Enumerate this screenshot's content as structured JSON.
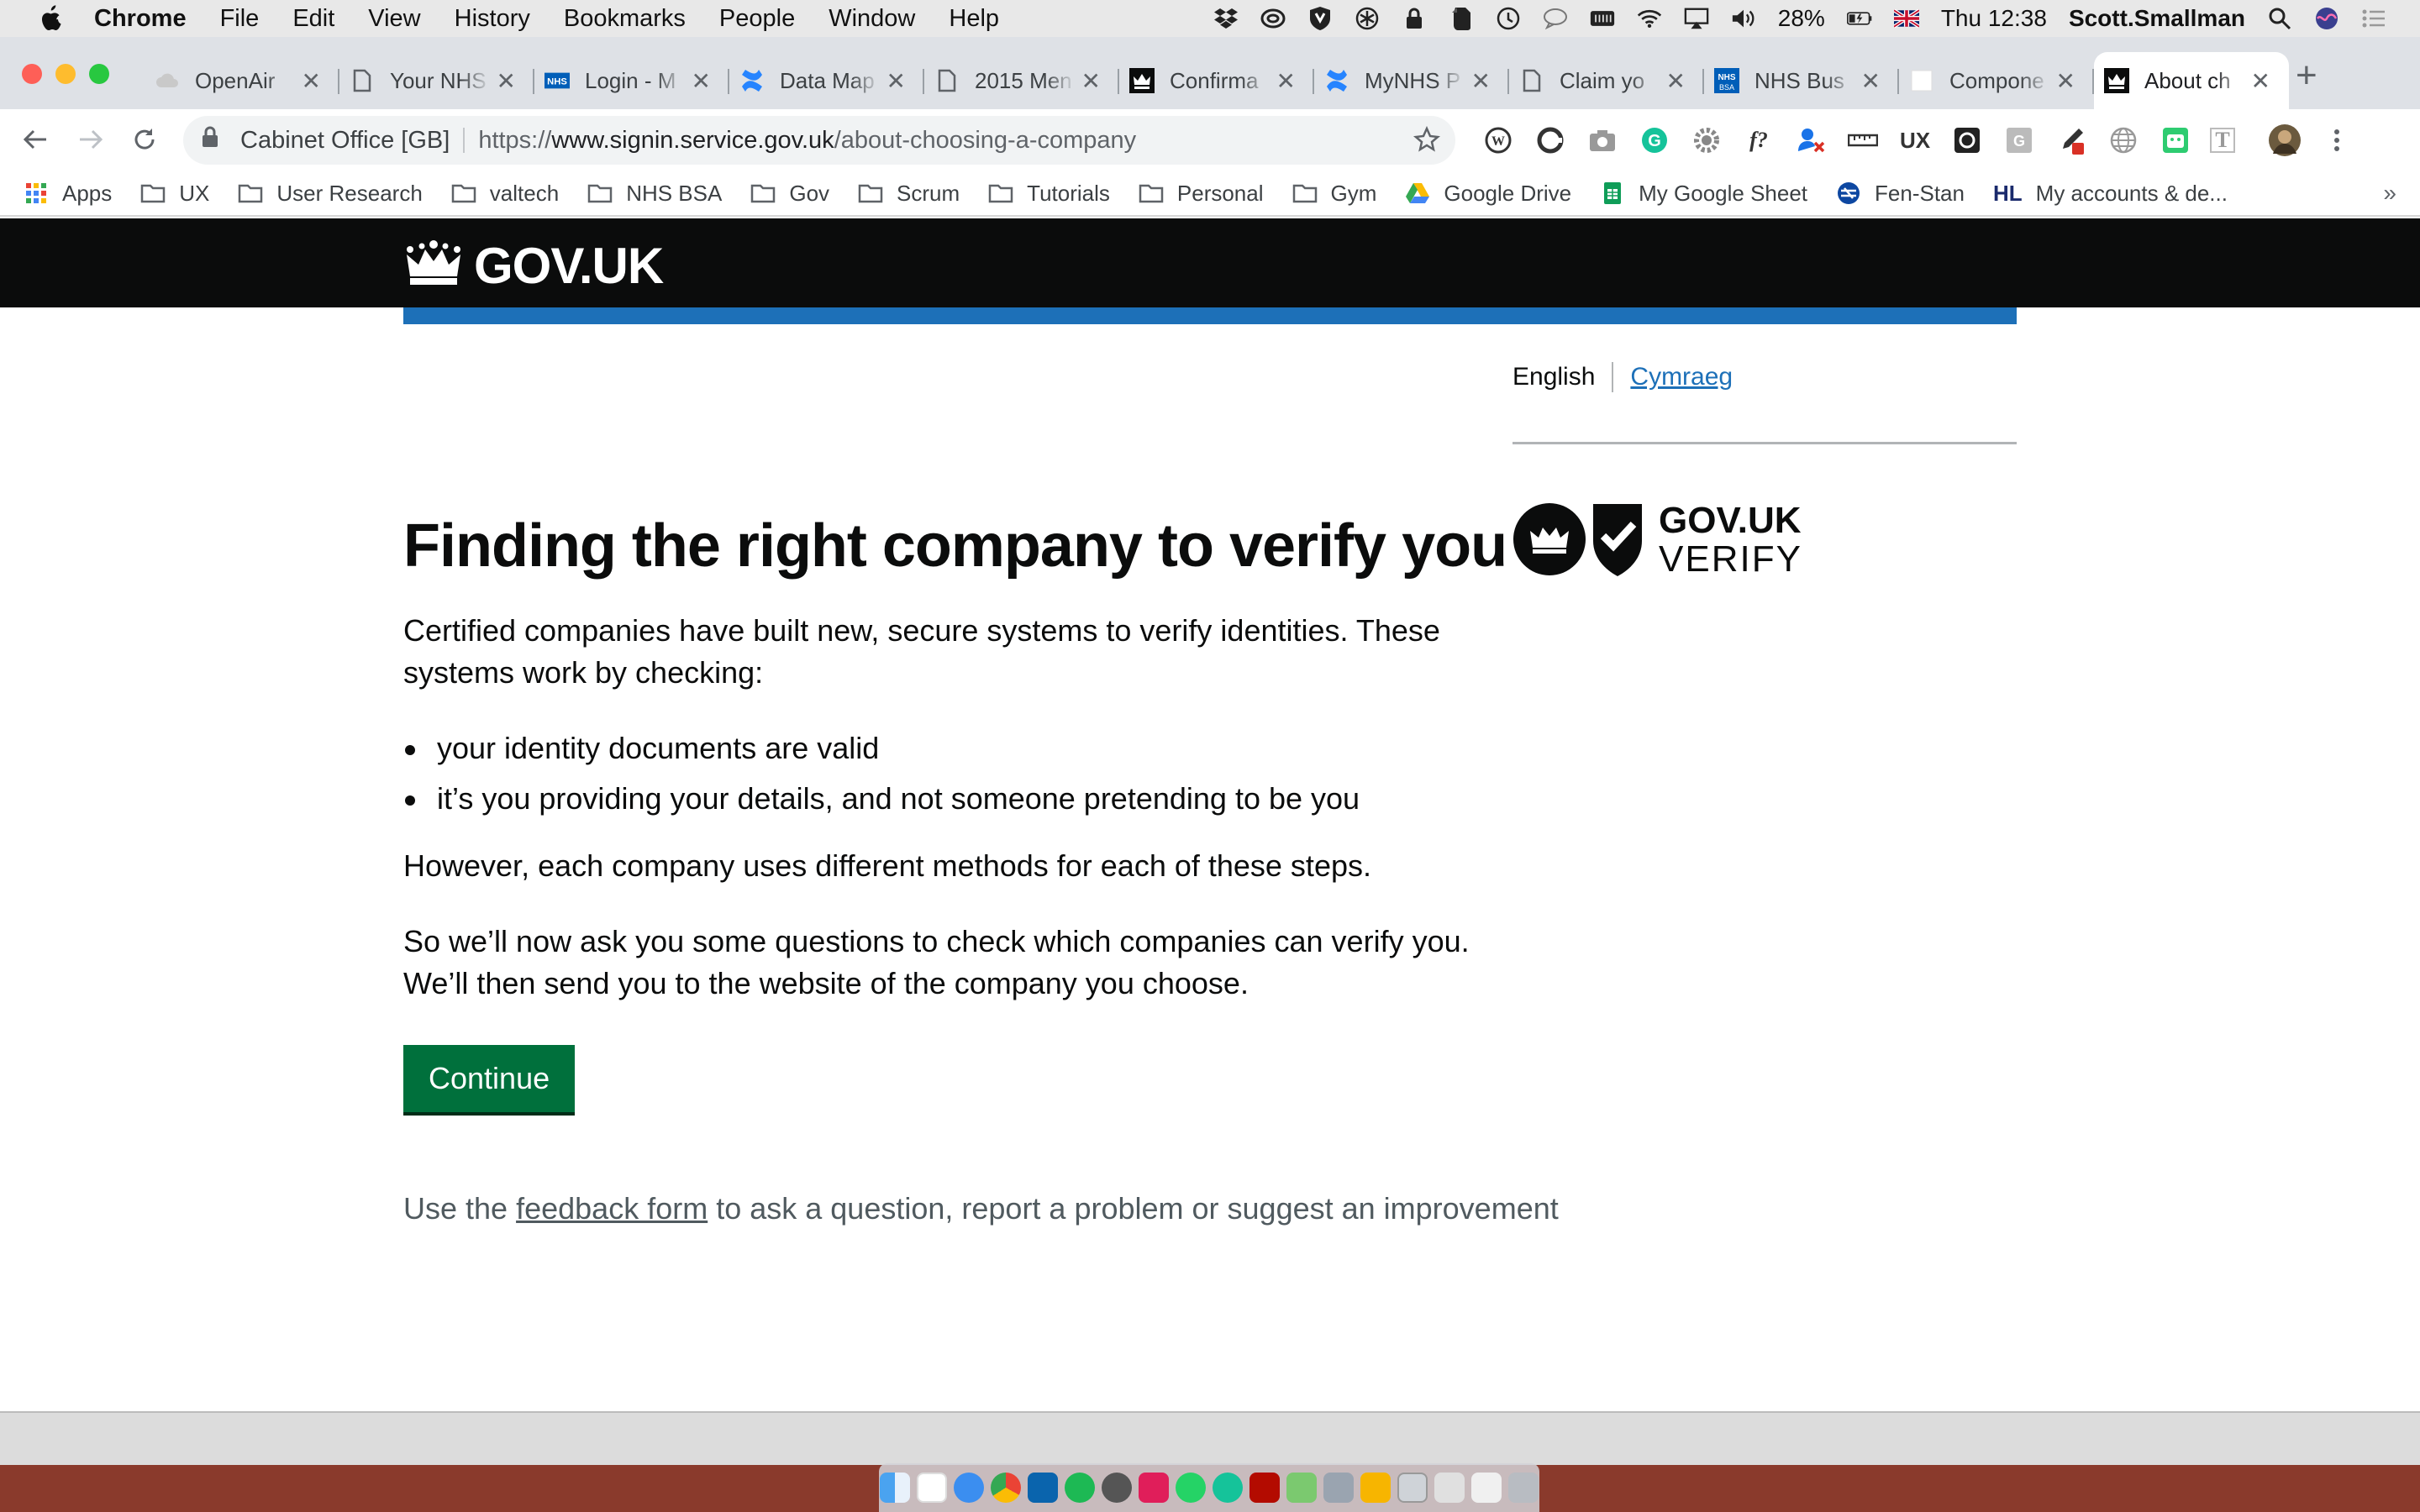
{
  "menubar": {
    "app": "Chrome",
    "items": [
      "File",
      "Edit",
      "View",
      "History",
      "Bookmarks",
      "People",
      "Window",
      "Help"
    ],
    "battery": "28%",
    "clock": "Thu 12:38",
    "user": "Scott.Smallman"
  },
  "tabs": [
    {
      "title": "OpenAir",
      "icon": "cloud-icon"
    },
    {
      "title": "Your NHS",
      "icon": "document-icon"
    },
    {
      "title": "Login - M",
      "icon": "nhs-icon"
    },
    {
      "title": "Data Map",
      "icon": "confluence-icon"
    },
    {
      "title": "2015 Men",
      "icon": "document-icon"
    },
    {
      "title": "Confirma",
      "icon": "crown-icon"
    },
    {
      "title": "MyNHS P",
      "icon": "confluence-icon"
    },
    {
      "title": "Claim yo",
      "icon": "document-icon"
    },
    {
      "title": "NHS Bus",
      "icon": "nhs-bsa-icon"
    },
    {
      "title": "Compone",
      "icon": "blank-icon"
    },
    {
      "title": "About ch",
      "icon": "crown-icon",
      "active": true
    }
  ],
  "omnibox": {
    "org": "Cabinet Office [GB]",
    "scheme": "https://",
    "host": "www.signin.service.gov.uk",
    "path": "/about-choosing-a-company"
  },
  "extensions": {
    "f_label": "f?",
    "ux_label": "UX",
    "t_label": "T"
  },
  "bookmarks": [
    {
      "label": "Apps",
      "icon": "apps-grid-icon"
    },
    {
      "label": "UX",
      "icon": "folder-icon"
    },
    {
      "label": "User Research",
      "icon": "folder-icon"
    },
    {
      "label": "valtech",
      "icon": "folder-icon"
    },
    {
      "label": "NHS BSA",
      "icon": "folder-icon"
    },
    {
      "label": "Gov",
      "icon": "folder-icon"
    },
    {
      "label": "Scrum",
      "icon": "folder-icon"
    },
    {
      "label": "Tutorials",
      "icon": "folder-icon"
    },
    {
      "label": "Personal",
      "icon": "folder-icon"
    },
    {
      "label": "Gym",
      "icon": "folder-icon"
    },
    {
      "label": "Google Drive",
      "icon": "google-drive-icon"
    },
    {
      "label": "My Google Sheet",
      "icon": "google-sheets-icon"
    },
    {
      "label": "Fen-Stan",
      "icon": "fen-stan-icon"
    },
    {
      "label": "My accounts & de...",
      "icon": "hl-icon",
      "prefix": "HL"
    }
  ],
  "bookmarks_more": "»",
  "gov": {
    "logo_text": "GOV.UK",
    "lang_current": "English",
    "lang_other": "Cymraeg",
    "verify_line1": "GOV.UK",
    "verify_line2": "VERIFY",
    "heading": "Finding the right company to verify you",
    "intro": "Certified companies have built new, secure systems to verify identities. These systems work by checking:",
    "bullets": [
      "your identity documents are valid",
      "it’s you providing your details, and not someone pretending to be you"
    ],
    "however": "However, each company uses different methods for each of these steps.",
    "so": "So we’ll now ask you some questions to check which companies can verify you. We’ll then send you to the website of the company you choose.",
    "continue": "Continue",
    "feedback_pre": "Use the ",
    "feedback_link": "feedback form",
    "feedback_post": " to ask a question, report a problem or suggest an improvement"
  },
  "colors": {
    "gov_black": "#0b0c0c",
    "gov_blue": "#1d70b8",
    "gov_green": "#00703c",
    "secondary_text": "#505a5f"
  }
}
